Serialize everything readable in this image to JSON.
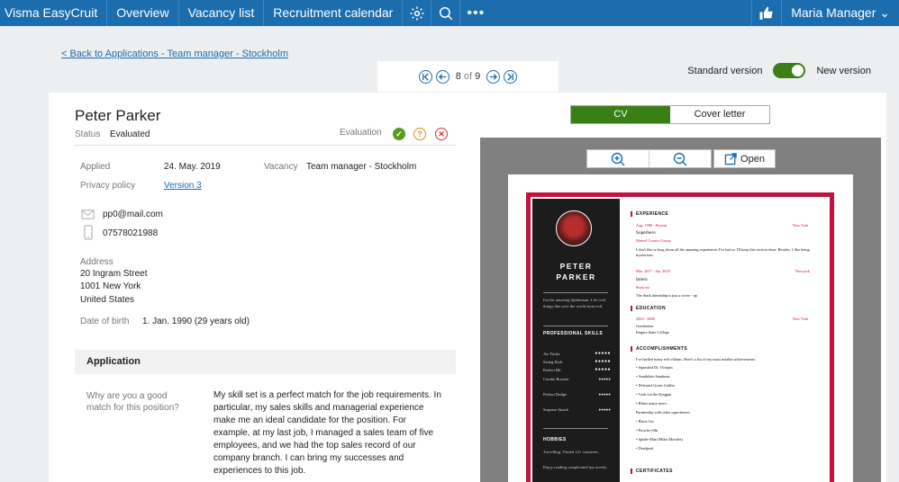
{
  "nav": {
    "brand": "Visma EasyCruit",
    "items": [
      "Overview",
      "Vacancy list",
      "Recruitment calendar"
    ],
    "more": "•••",
    "user": "Maria Manager"
  },
  "back_link": "< Back to Applications - Team manager - Stockholm",
  "pager": {
    "current": "8",
    "of": "of",
    "total": "9"
  },
  "version": {
    "standard": "Standard version",
    "new": "New version",
    "new_enabled": true
  },
  "candidate": {
    "name": "Peter Parker",
    "status_label": "Status",
    "status_value": "Evaluated",
    "evaluation_label": "Evaluation",
    "applied_label": "Applied",
    "applied_value": "24. May. 2019",
    "vacancy_label": "Vacancy",
    "vacancy_value": "Team manager - Stockholm",
    "privacy_label": "Privacy policy",
    "privacy_value": "Version 3",
    "email": "pp0@mail.com",
    "phone": "07578021988",
    "address_label": "Address",
    "address_lines": [
      "20 Ingram Street",
      "1001 New York",
      "United States"
    ],
    "dob_label": "Date of birth",
    "dob_value": "1. Jan. 1990 (29 years old)"
  },
  "application": {
    "section_title": "Application",
    "question": "Why are you a good match for this position?",
    "answer": "My skill set is a perfect match for the job requirements. In particular, my sales skills and managerial experience make me an ideal candidate for the position. For example, at my last job, I managed a sales team of five employees, and we had the top sales record of our company branch. I can bring my successes and experiences to this job."
  },
  "doc_tabs": {
    "cv": "CV",
    "cover": "Cover letter",
    "active": "cv"
  },
  "viewer": {
    "open_label": "Open"
  },
  "cv": {
    "name_first": "PETER",
    "name_last": "PARKER",
    "intro": "I'm the amazing Spiderman. I do cool things like save the world from evil.",
    "skills_title": "PROFESSIONAL SKILLS",
    "skills": [
      {
        "name": "Air Tricks",
        "dots": "●●●●●"
      },
      {
        "name": "Swing Kick",
        "dots": "●●●●●"
      },
      {
        "name": "Perfect Hit",
        "dots": "●●●●●"
      },
      {
        "name": "Combo Booster",
        "dots": "●●●●●"
      },
      {
        "name": "Perfect Dodge",
        "dots": "●●●●●"
      },
      {
        "name": "Surprise Attack",
        "dots": "●●●●●"
      }
    ],
    "hobbies_title": "HOBBIES",
    "hobbies": [
      "Travelling: Visited 12+ countries.",
      "Enjoy reading complicated spy novels."
    ],
    "experience_title": "EXPERIENCE",
    "exp1_date": "Aug. 1900 - Present",
    "exp1_loc": "New York",
    "exp1_title": "Superhero",
    "exp1_org": "Marvel Comics Group",
    "exp1_desc": "I don't like to brag about all the amazing experiences I've had so I'll keep this section short. Besides, I like being mysterious.",
    "exp2_date": "Mar. 2017 - Jan. 2018",
    "exp2_loc": "Newyork",
    "exp2_title": "Intern",
    "exp2_org": "Stark inc",
    "exp2_desc": "The Stark internship is just a cover - up",
    "education_title": "EDUCATION",
    "edu_date": "2004 - 2008",
    "edu_loc": "New York",
    "edu_title": "Graduation",
    "edu_org": "Empire State College",
    "accomp_title": "ACCOMPLISHMENTS",
    "accomp_intro": "I've battled many evil villains. Here's a list of my most notable achievements:",
    "accomp_list": [
      "Squashed Dr. Octopus",
      "Annihilate Sandman",
      "Defeated Green Goblin",
      "Took out the Kingpin",
      "Rihno many more.."
    ],
    "partner_intro": "Partnership with other superheroes",
    "partner_list": [
      "Black Cat",
      "Prowler Silk",
      "Spider-Man (Miles Morales)",
      "Deadpool"
    ],
    "cert_title": "CERTIFICATES"
  }
}
